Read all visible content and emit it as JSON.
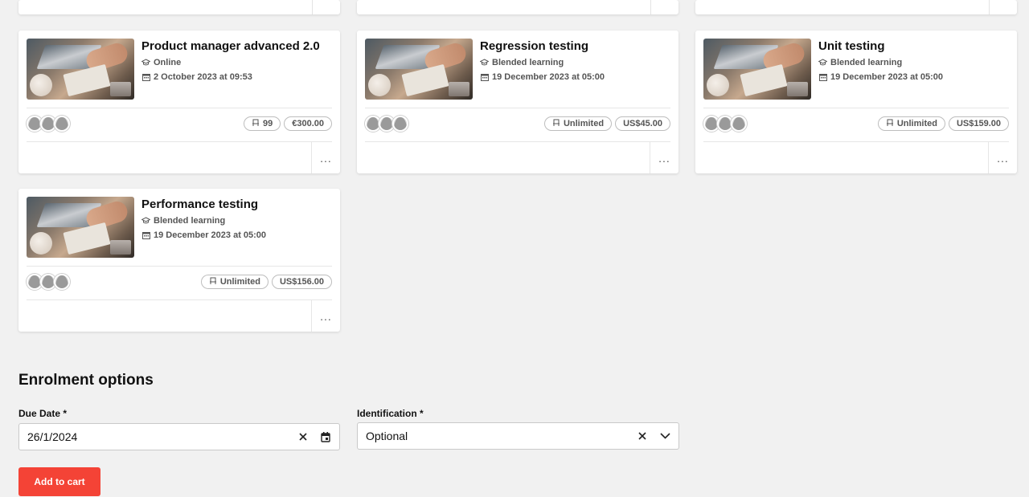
{
  "cards": [
    {
      "title": "Product manager advanced 2.0",
      "delivery": "Online",
      "date": "2 October 2023 at 09:53",
      "seats": "99",
      "price": "€300.00"
    },
    {
      "title": "Regression testing",
      "delivery": "Blended learning",
      "date": "19 December 2023 at 05:00",
      "seats": "Unlimited",
      "price": "US$45.00"
    },
    {
      "title": "Unit testing",
      "delivery": "Blended learning",
      "date": "19 December 2023 at 05:00",
      "seats": "Unlimited",
      "price": "US$159.00"
    },
    {
      "title": "Performance testing",
      "delivery": "Blended learning",
      "date": "19 December 2023 at 05:00",
      "seats": "Unlimited",
      "price": "US$156.00"
    }
  ],
  "enrolment": {
    "title": "Enrolment options",
    "due_date_label": "Due Date *",
    "due_date_value": "26/1/2024",
    "identification_label": "Identification *",
    "identification_value": "Optional"
  },
  "actions": {
    "add_to_cart": "Add to cart",
    "more": "..."
  },
  "icons": {
    "delivery": "graduation-cap-icon",
    "date": "calendar-icon",
    "seats": "seat-icon",
    "more": "more-horizontal-icon",
    "clear": "clear-icon",
    "calendar_picker": "calendar-icon",
    "dropdown": "chevron-down-icon"
  },
  "colors": {
    "background": "#f1f1f1",
    "primary_button": "#f44336"
  }
}
